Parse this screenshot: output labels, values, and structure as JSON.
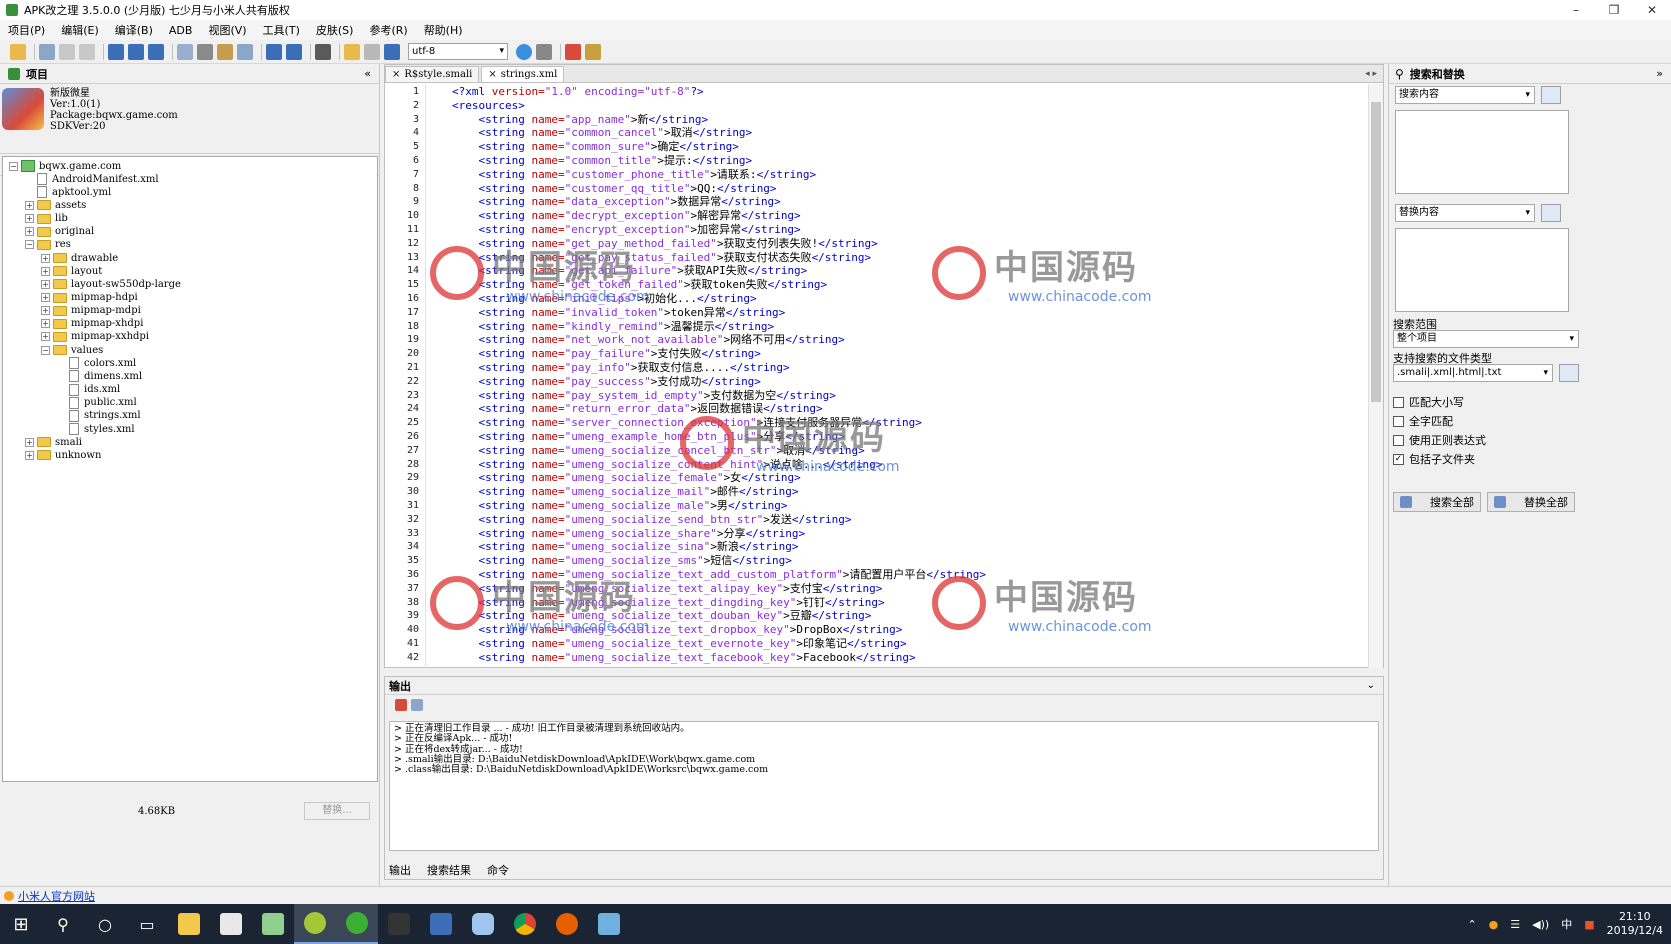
{
  "window": {
    "title": "APK改之理 3.5.0.0 (少月版)  七少月与小米人共有版权",
    "min": "–",
    "max": "❐",
    "close": "✕"
  },
  "menu": [
    "项目(P)",
    "编辑(E)",
    "编译(B)",
    "ADB",
    "视图(V)",
    "工具(T)",
    "皮肤(S)",
    "参考(R)",
    "帮助(H)"
  ],
  "toolbar": {
    "encoding": "utf-8"
  },
  "project_panel": {
    "title": "项目",
    "collapse": "«",
    "app": {
      "name": "新版微星",
      "version": "Ver:1.0(1)",
      "package": "Package:bqwx.game.com",
      "sdk": "SDKVer:20"
    },
    "tree": [
      {
        "label": "bqwx.game.com",
        "kind": "proj",
        "level": 0,
        "exp": "−"
      },
      {
        "label": "AndroidManifest.xml",
        "kind": "file",
        "level": 1,
        "exp": ""
      },
      {
        "label": "apktool.yml",
        "kind": "file",
        "level": 1,
        "exp": ""
      },
      {
        "label": "assets",
        "kind": "folder",
        "level": 1,
        "exp": "+"
      },
      {
        "label": "lib",
        "kind": "folder",
        "level": 1,
        "exp": "+"
      },
      {
        "label": "original",
        "kind": "folder",
        "level": 1,
        "exp": "+"
      },
      {
        "label": "res",
        "kind": "folder",
        "level": 1,
        "exp": "−"
      },
      {
        "label": "drawable",
        "kind": "folder",
        "level": 2,
        "exp": "+"
      },
      {
        "label": "layout",
        "kind": "folder",
        "level": 2,
        "exp": "+"
      },
      {
        "label": "layout-sw550dp-large",
        "kind": "folder",
        "level": 2,
        "exp": "+"
      },
      {
        "label": "mipmap-hdpi",
        "kind": "folder",
        "level": 2,
        "exp": "+"
      },
      {
        "label": "mipmap-mdpi",
        "kind": "folder",
        "level": 2,
        "exp": "+"
      },
      {
        "label": "mipmap-xhdpi",
        "kind": "folder",
        "level": 2,
        "exp": "+"
      },
      {
        "label": "mipmap-xxhdpi",
        "kind": "folder",
        "level": 2,
        "exp": "+"
      },
      {
        "label": "values",
        "kind": "folder",
        "level": 2,
        "exp": "−"
      },
      {
        "label": "colors.xml",
        "kind": "file",
        "level": 3,
        "exp": ""
      },
      {
        "label": "dimens.xml",
        "kind": "file",
        "level": 3,
        "exp": ""
      },
      {
        "label": "ids.xml",
        "kind": "file",
        "level": 3,
        "exp": ""
      },
      {
        "label": "public.xml",
        "kind": "file",
        "level": 3,
        "exp": ""
      },
      {
        "label": "strings.xml",
        "kind": "file",
        "level": 3,
        "exp": ""
      },
      {
        "label": "styles.xml",
        "kind": "file",
        "level": 3,
        "exp": ""
      },
      {
        "label": "smali",
        "kind": "folder",
        "level": 1,
        "exp": "+"
      },
      {
        "label": "unknown",
        "kind": "folder",
        "level": 1,
        "exp": "+"
      }
    ],
    "file_size": "4.68KB",
    "replace_button": "替换..."
  },
  "editor": {
    "tabs": [
      "R$style.smali",
      "strings.xml"
    ],
    "lines": [
      {
        "n": "1",
        "pre": "<?xml ",
        "name": "version=",
        "val": "\"1.0\" encoding=\"utf-8\"",
        "inner": "",
        "post": "?>"
      },
      {
        "n": "2",
        "pre": "<resources>",
        "name": "",
        "val": "",
        "inner": "",
        "post": ""
      },
      {
        "n": "3",
        "pre": "    <string ",
        "name": "name=",
        "val": "\"app_name\"",
        "inner": ">新",
        "post": "</string>"
      },
      {
        "n": "4",
        "pre": "    <string ",
        "name": "name=",
        "val": "\"common_cancel\"",
        "inner": ">取消",
        "post": "</string>"
      },
      {
        "n": "5",
        "pre": "    <string ",
        "name": "name=",
        "val": "\"common_sure\"",
        "inner": ">确定",
        "post": "</string>"
      },
      {
        "n": "6",
        "pre": "    <string ",
        "name": "name=",
        "val": "\"common_title\"",
        "inner": ">提示:",
        "post": "</string>"
      },
      {
        "n": "7",
        "pre": "    <string ",
        "name": "name=",
        "val": "\"customer_phone_title\"",
        "inner": ">请联系:",
        "post": "</string>"
      },
      {
        "n": "8",
        "pre": "    <string ",
        "name": "name=",
        "val": "\"customer_qq_title\"",
        "inner": ">QQ:",
        "post": "</string>"
      },
      {
        "n": "9",
        "pre": "    <string ",
        "name": "name=",
        "val": "\"data_exception\"",
        "inner": ">数据异常",
        "post": "</string>"
      },
      {
        "n": "10",
        "pre": "    <string ",
        "name": "name=",
        "val": "\"decrypt_exception\"",
        "inner": ">解密异常",
        "post": "</string>"
      },
      {
        "n": "11",
        "pre": "    <string ",
        "name": "name=",
        "val": "\"encrypt_exception\"",
        "inner": ">加密异常",
        "post": "</string>"
      },
      {
        "n": "12",
        "pre": "    <string ",
        "name": "name=",
        "val": "\"get_pay_method_failed\"",
        "inner": ">获取支付列表失败!",
        "post": "</string>"
      },
      {
        "n": "13",
        "pre": "    <string ",
        "name": "name=",
        "val": "\"get_pay_status_failed\"",
        "inner": ">获取支付状态失败",
        "post": "</string>"
      },
      {
        "n": "14",
        "pre": "    <string ",
        "name": "name=",
        "val": "\"get_api_failure\"",
        "inner": ">获取API失败",
        "post": "</string>"
      },
      {
        "n": "15",
        "pre": "    <string ",
        "name": "name=",
        "val": "\"get_token_failed\"",
        "inner": ">获取token失败",
        "post": "</string>"
      },
      {
        "n": "16",
        "pre": "    <string ",
        "name": "name=",
        "val": "\"init_tips\"",
        "inner": ">初始化...",
        "post": "</string>"
      },
      {
        "n": "17",
        "pre": "    <string ",
        "name": "name=",
        "val": "\"invalid_token\"",
        "inner": ">token异常",
        "post": "</string>"
      },
      {
        "n": "18",
        "pre": "    <string ",
        "name": "name=",
        "val": "\"kindly_remind\"",
        "inner": ">温馨提示",
        "post": "</string>"
      },
      {
        "n": "19",
        "pre": "    <string ",
        "name": "name=",
        "val": "\"net_work_not_available\"",
        "inner": ">网络不可用",
        "post": "</string>"
      },
      {
        "n": "20",
        "pre": "    <string ",
        "name": "name=",
        "val": "\"pay_failure\"",
        "inner": ">支付失败",
        "post": "</string>"
      },
      {
        "n": "21",
        "pre": "    <string ",
        "name": "name=",
        "val": "\"pay_info\"",
        "inner": ">获取支付信息....",
        "post": "</string>"
      },
      {
        "n": "22",
        "pre": "    <string ",
        "name": "name=",
        "val": "\"pay_success\"",
        "inner": ">支付成功",
        "post": "</string>"
      },
      {
        "n": "23",
        "pre": "    <string ",
        "name": "name=",
        "val": "\"pay_system_id_empty\"",
        "inner": ">支付数据为空",
        "post": "</string>"
      },
      {
        "n": "24",
        "pre": "    <string ",
        "name": "name=",
        "val": "\"return_error_data\"",
        "inner": ">返回数据错误",
        "post": "</string>"
      },
      {
        "n": "25",
        "pre": "    <string ",
        "name": "name=",
        "val": "\"server_connection_exception\"",
        "inner": ">连接支付服务器异常",
        "post": "</string>"
      },
      {
        "n": "26",
        "pre": "    <string ",
        "name": "name=",
        "val": "\"umeng_example_home_btn_plus\"",
        "inner": ">分享",
        "post": "</string>"
      },
      {
        "n": "27",
        "pre": "    <string ",
        "name": "name=",
        "val": "\"umeng_socialize_cancel_btn_str\"",
        "inner": ">取消",
        "post": "</string>"
      },
      {
        "n": "28",
        "pre": "    <string ",
        "name": "name=",
        "val": "\"umeng_socialize_content_hint\"",
        "inner": ">说点啥...",
        "post": "</string>"
      },
      {
        "n": "29",
        "pre": "    <string ",
        "name": "name=",
        "val": "\"umeng_socialize_female\"",
        "inner": ">女",
        "post": "</string>"
      },
      {
        "n": "30",
        "pre": "    <string ",
        "name": "name=",
        "val": "\"umeng_socialize_mail\"",
        "inner": ">邮件",
        "post": "</string>"
      },
      {
        "n": "31",
        "pre": "    <string ",
        "name": "name=",
        "val": "\"umeng_socialize_male\"",
        "inner": ">男",
        "post": "</string>"
      },
      {
        "n": "32",
        "pre": "    <string ",
        "name": "name=",
        "val": "\"umeng_socialize_send_btn_str\"",
        "inner": ">发送",
        "post": "</string>"
      },
      {
        "n": "33",
        "pre": "    <string ",
        "name": "name=",
        "val": "\"umeng_socialize_share\"",
        "inner": ">分享",
        "post": "</string>"
      },
      {
        "n": "34",
        "pre": "    <string ",
        "name": "name=",
        "val": "\"umeng_socialize_sina\"",
        "inner": ">新浪",
        "post": "</string>"
      },
      {
        "n": "35",
        "pre": "    <string ",
        "name": "name=",
        "val": "\"umeng_socialize_sms\"",
        "inner": ">短信",
        "post": "</string>"
      },
      {
        "n": "36",
        "pre": "    <string ",
        "name": "name=",
        "val": "\"umeng_socialize_text_add_custom_platform\"",
        "inner": ">请配置用户平台",
        "post": "</string>"
      },
      {
        "n": "37",
        "pre": "    <string ",
        "name": "name=",
        "val": "\"umeng_socialize_text_alipay_key\"",
        "inner": ">支付宝",
        "post": "</string>"
      },
      {
        "n": "38",
        "pre": "    <string ",
        "name": "name=",
        "val": "\"umeng_socialize_text_dingding_key\"",
        "inner": ">钉钉",
        "post": "</string>"
      },
      {
        "n": "39",
        "pre": "    <string ",
        "name": "name=",
        "val": "\"umeng_socialize_text_douban_key\"",
        "inner": ">豆瓣",
        "post": "</string>"
      },
      {
        "n": "40",
        "pre": "    <string ",
        "name": "name=",
        "val": "\"umeng_socialize_text_dropbox_key\"",
        "inner": ">DropBox",
        "post": "</string>"
      },
      {
        "n": "41",
        "pre": "    <string ",
        "name": "name=",
        "val": "\"umeng_socialize_text_evernote_key\"",
        "inner": ">印象笔记",
        "post": "</string>"
      },
      {
        "n": "42",
        "pre": "    <string ",
        "name": "name=",
        "val": "\"umeng_socialize_text_facebook_key\"",
        "inner": ">Facebook",
        "post": "</string>"
      }
    ]
  },
  "watermark": {
    "text": "中国源码",
    "url": "www.chinacode.com"
  },
  "output": {
    "title": "输出",
    "collapse": "⌄",
    "lines": [
      "> 正在清理旧工作目录 ...  - 成功! 旧工作目录被清理到系统回收站内。",
      "> 正在反编译Apk...  - 成功!",
      "> 正在将dex转成jar...  - 成功!",
      "> .smali输出目录: D:\\BaiduNetdiskDownload\\ApkIDE\\Work\\bqwx.game.com",
      "> .class输出目录: D:\\BaiduNetdiskDownload\\ApkIDE\\Worksrc\\bqwx.game.com"
    ],
    "tabs": [
      "输出",
      "搜索结果",
      "命令"
    ]
  },
  "search_panel": {
    "title": "搜索和替换",
    "collapse": "»",
    "search_placeholder": "搜索内容",
    "replace_placeholder": "替换内容",
    "scope_label": "搜索范围",
    "scope_value": "整个项目",
    "filetypes_label": "支持搜索的文件类型",
    "filetypes_value": ".smali|.xml|.html|.txt",
    "options": [
      {
        "label": "匹配大小写",
        "checked": false
      },
      {
        "label": "全字匹配",
        "checked": false
      },
      {
        "label": "使用正则表达式",
        "checked": false
      },
      {
        "label": "包括子文件夹",
        "checked": true
      }
    ],
    "search_all": "搜索全部",
    "replace_all": "替换全部"
  },
  "statusbar": {
    "link": "小米人官方网站"
  },
  "taskbar": {
    "ime": "中",
    "time": "21:10",
    "date": "2019/12/4"
  }
}
